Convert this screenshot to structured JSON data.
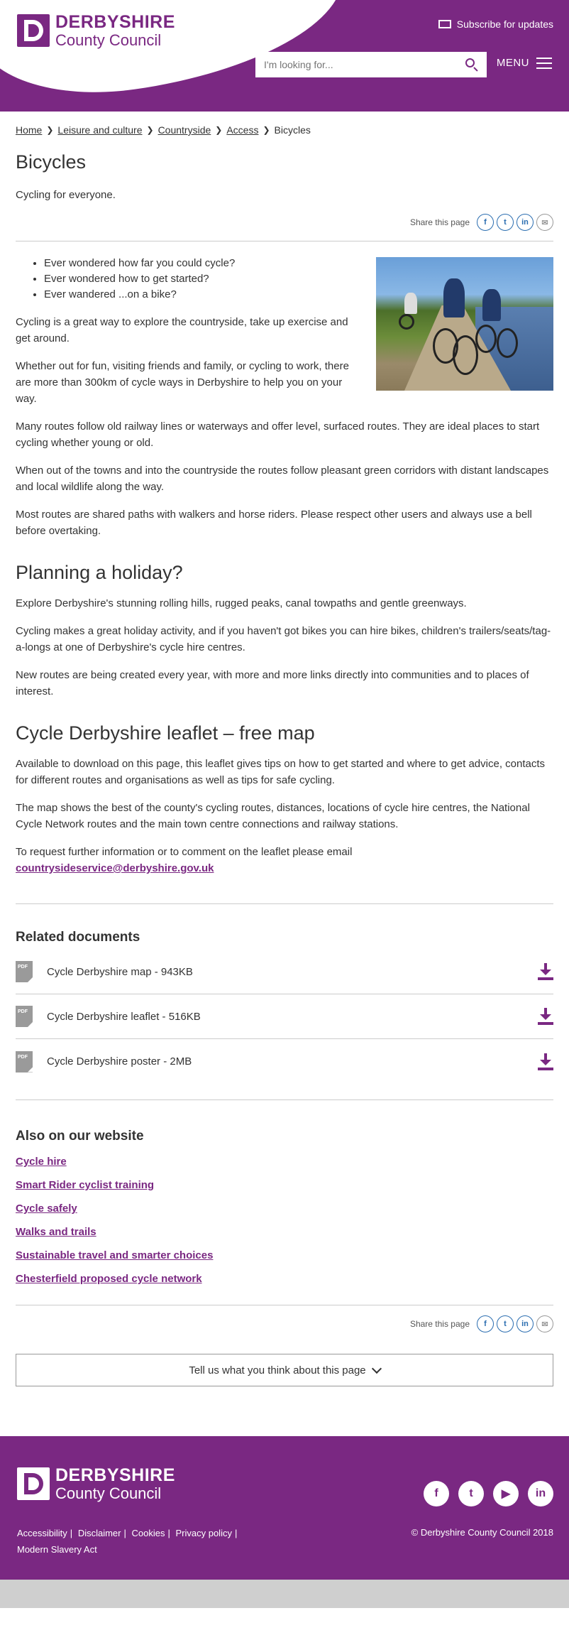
{
  "header": {
    "brand_line1": "DERBYSHIRE",
    "brand_line2": "County Council",
    "subscribe": "Subscribe for updates",
    "search_placeholder": "I'm looking for...",
    "menu": "MENU"
  },
  "breadcrumb": [
    "Home",
    "Leisure and culture",
    "Countryside",
    "Access",
    "Bicycles"
  ],
  "page": {
    "title": "Bicycles",
    "lead": "Cycling for everyone.",
    "share_label": "Share this page",
    "share_icons": [
      "f",
      "t",
      "in",
      "✉"
    ]
  },
  "intro": {
    "bullets": [
      "Ever wondered how far you could cycle?",
      "Ever wondered how to get started?",
      "Ever wandered ...on a bike?"
    ],
    "paras": [
      "Cycling is a great way to explore the countryside, take up exercise and get around.",
      "Whether out for fun, visiting friends and family, or cycling to work, there are more than 300km of cycle ways in Derbyshire to help you on your way."
    ]
  },
  "body_paras": [
    "Many routes follow old railway lines or waterways and offer level, surfaced routes. They are ideal places to start cycling whether young or old.",
    "When out of the towns and into the countryside the routes follow pleasant green corridors with distant landscapes and local wildlife along the way.",
    "Most routes are shared paths with walkers and horse riders. Please respect other users and always use a bell before overtaking."
  ],
  "holiday": {
    "heading": "Planning a holiday?",
    "paras": [
      "Explore Derbyshire's stunning rolling hills, rugged peaks, canal towpaths and gentle greenways.",
      "Cycling makes a great holiday activity, and if you haven't got bikes you can hire bikes, children's trailers/seats/tag-a-longs at one of Derbyshire's cycle hire centres.",
      "New routes are being created every year, with more and more links directly into communities and to places of interest."
    ]
  },
  "leaflet": {
    "heading": "Cycle Derbyshire leaflet – free map",
    "paras": [
      "Available to download on this page, this leaflet gives tips on how to get started and where to get advice, contacts for different routes and organisations as well as tips for safe cycling.",
      "The map shows the best of the county's cycling routes, distances, locations of cycle hire centres, the National Cycle Network routes and the main town centre connections and railway stations."
    ],
    "contact_text": "To request further information or to comment on the leaflet please email ",
    "contact_email": "countrysideservice@derbyshire.gov.uk"
  },
  "related": {
    "heading": "Related documents",
    "pdf_label": "PDF",
    "docs": [
      "Cycle Derbyshire map - 943KB",
      "Cycle Derbyshire leaflet - 516KB",
      "Cycle Derbyshire poster - 2MB"
    ]
  },
  "also": {
    "heading": "Also on our website",
    "links": [
      "Cycle hire",
      "Smart Rider cyclist training",
      "Cycle safely",
      "Walks and trails",
      "Sustainable travel and smarter choices",
      "Chesterfield proposed cycle network"
    ]
  },
  "feedback": "Tell us what you think about this page",
  "footer": {
    "links": [
      "Accessibility",
      "Disclaimer",
      "Cookies",
      "Privacy policy",
      "Modern Slavery Act"
    ],
    "copyright": "© Derbyshire County Council 2018",
    "social": [
      "f",
      "t",
      "▶",
      "in"
    ]
  },
  "colors": {
    "brand": "#7a2882",
    "share_blue": "#2a6db0"
  }
}
